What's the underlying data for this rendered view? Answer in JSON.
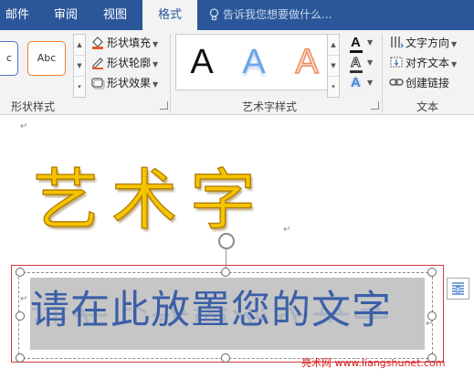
{
  "tabs": [
    "邮件",
    "审阅",
    "视图",
    "格式"
  ],
  "active_tab": "格式",
  "tell_me": "告诉我您想要做什么...",
  "ribbon": {
    "shape_styles": {
      "preview_left": "c",
      "preview_right": "Abc",
      "fill": "形状填充",
      "outline": "形状轮廓",
      "effects": "形状效果",
      "label": "形状样式"
    },
    "wordart_styles": {
      "samples": [
        "A",
        "A",
        "A"
      ],
      "label": "艺术字样式",
      "text_fill_letter": "A",
      "text_outline_letter": "A",
      "text_effects_letter": "A"
    },
    "text": {
      "direction": "文字方向",
      "align": "对齐文本",
      "link": "创建链接",
      "label": "文本"
    }
  },
  "document": {
    "wordart_title": "艺术字",
    "textbox_text": "请在此放置您的文字"
  },
  "watermark": "亮术网 www.liangshunet.com",
  "colors": {
    "tab_bar": "#2b579a",
    "wordart_gold": "#f5c400",
    "textbox_text": "#3b5fa8",
    "selection_red": "#d23a3a"
  }
}
